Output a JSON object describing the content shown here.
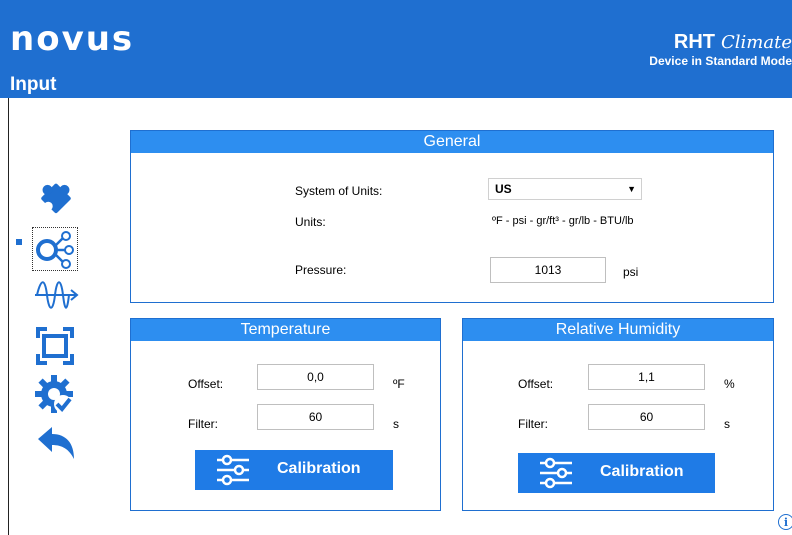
{
  "header": {
    "logo": "novus",
    "page_title": "Input",
    "product_name": "RHT",
    "product_suffix": "Climate",
    "device_mode": "Device in Standard Mode"
  },
  "sidebar": {
    "items": [
      {
        "icon": "puzzle-icon"
      },
      {
        "icon": "inputs-node-icon",
        "selected": true
      },
      {
        "icon": "signal-wave-icon"
      },
      {
        "icon": "display-frame-icon"
      },
      {
        "icon": "gear-check-icon"
      },
      {
        "icon": "back-arrow-icon"
      }
    ]
  },
  "general": {
    "title": "General",
    "system_of_units_label": "System of Units:",
    "system_of_units_value": "US",
    "units_label": "Units:",
    "units_value": "ºF - psi - gr/ft³ - gr/lb - BTU/lb",
    "pressure_label": "Pressure:",
    "pressure_value": "1013",
    "pressure_unit": "psi"
  },
  "temperature": {
    "title": "Temperature",
    "offset_label": "Offset:",
    "offset_value": "0,0",
    "offset_unit": "ºF",
    "filter_label": "Filter:",
    "filter_value": "60",
    "filter_unit": "s",
    "calibration_label": "Calibration"
  },
  "humidity": {
    "title": "Relative Humidity",
    "offset_label": "Offset:",
    "offset_value": "1,1",
    "offset_unit": "%",
    "filter_label": "Filter:",
    "filter_value": "60",
    "filter_unit": "s",
    "calibration_label": "Calibration"
  },
  "info_label": "i",
  "colors": {
    "header_blue": "#1f6fd0",
    "panel_header_blue": "#2d8ef0",
    "button_blue": "#1f7be6"
  }
}
